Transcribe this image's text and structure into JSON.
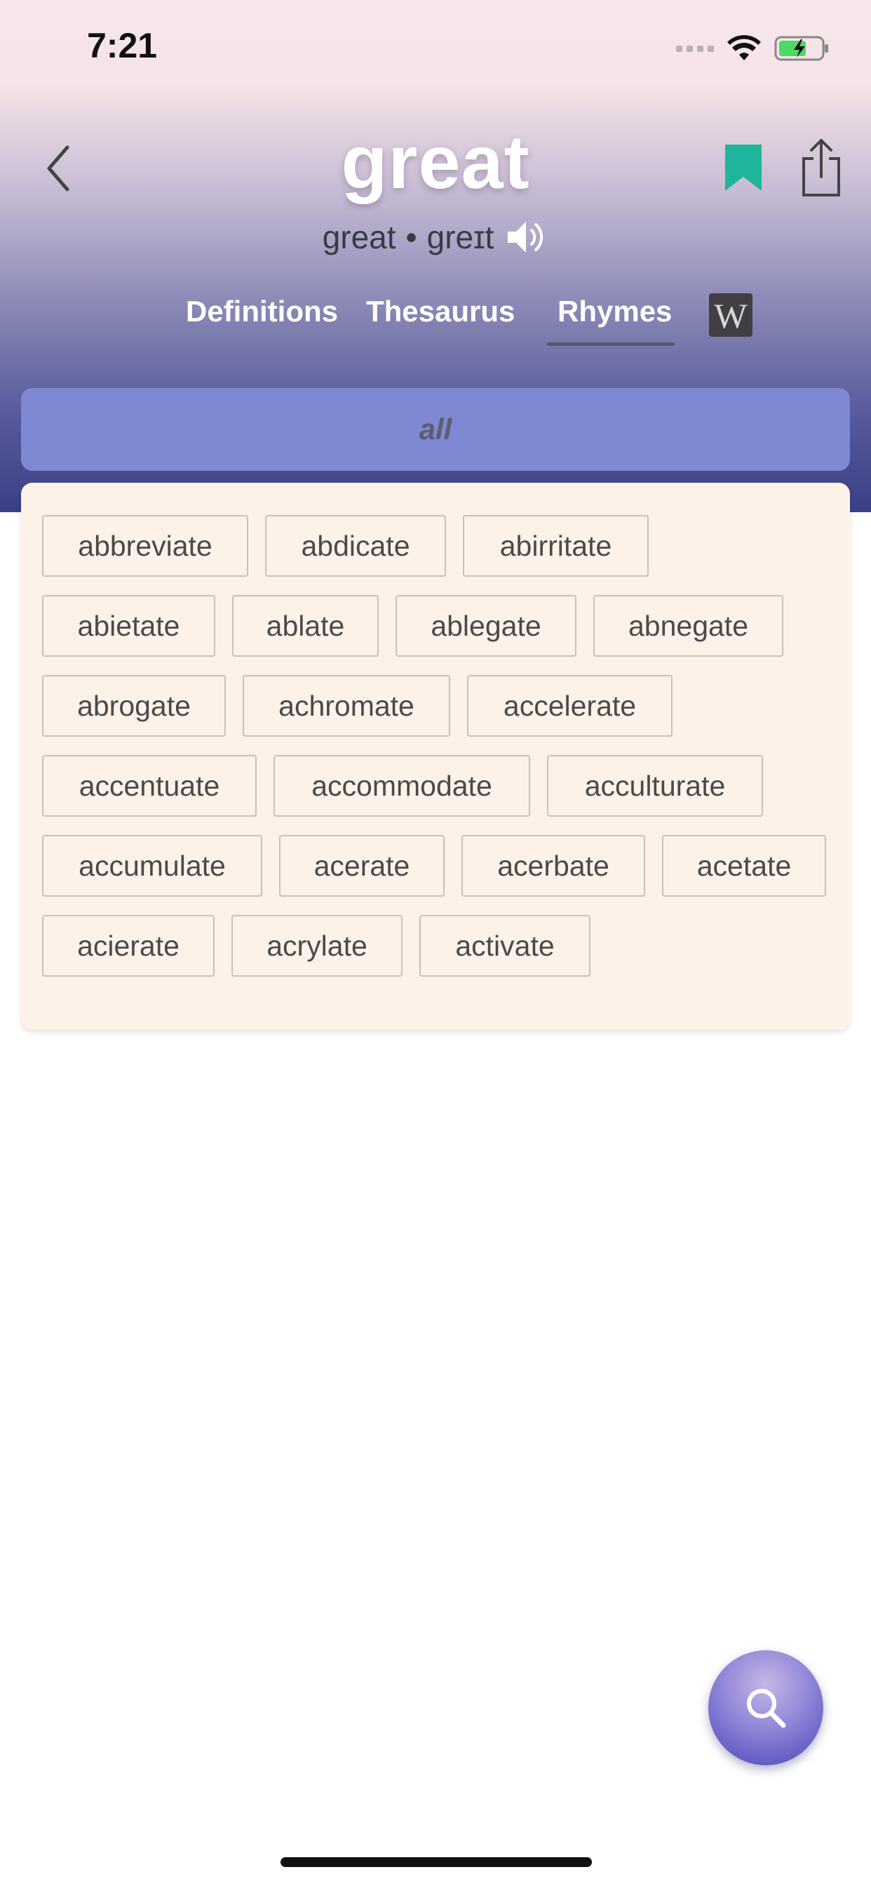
{
  "status_bar": {
    "time": "7:21"
  },
  "header": {
    "word": "great",
    "pronunciation_word": "great",
    "pronunciation_separator": "•",
    "pronunciation_ipa": "greɪt"
  },
  "tabs": [
    {
      "label": "Definitions",
      "selected": false
    },
    {
      "label": "Thesaurus",
      "selected": false
    },
    {
      "label": "Rhymes",
      "selected": true
    }
  ],
  "wiki_button_label": "W",
  "filter": {
    "label": "all"
  },
  "rhymes": [
    "abbreviate",
    "abdicate",
    "abirritate",
    "abietate",
    "ablate",
    "ablegate",
    "abnegate",
    "abrogate",
    "achromate",
    "accelerate",
    "accentuate",
    "accommodate",
    "acculturate",
    "accumulate",
    "acerate",
    "acerbate",
    "acetate",
    "acierate",
    "acrylate",
    "activate"
  ],
  "colors": {
    "bookmark": "#1fb59a",
    "filter_bar": "#7f88d3",
    "card_background": "#fdf2e7",
    "fab": "#5b56c2"
  },
  "icons": {
    "back": "chevron-left-icon",
    "bookmark": "bookmark-icon",
    "share": "share-icon",
    "speaker": "speaker-icon",
    "wiki": "wikipedia-icon",
    "search": "search-icon"
  }
}
